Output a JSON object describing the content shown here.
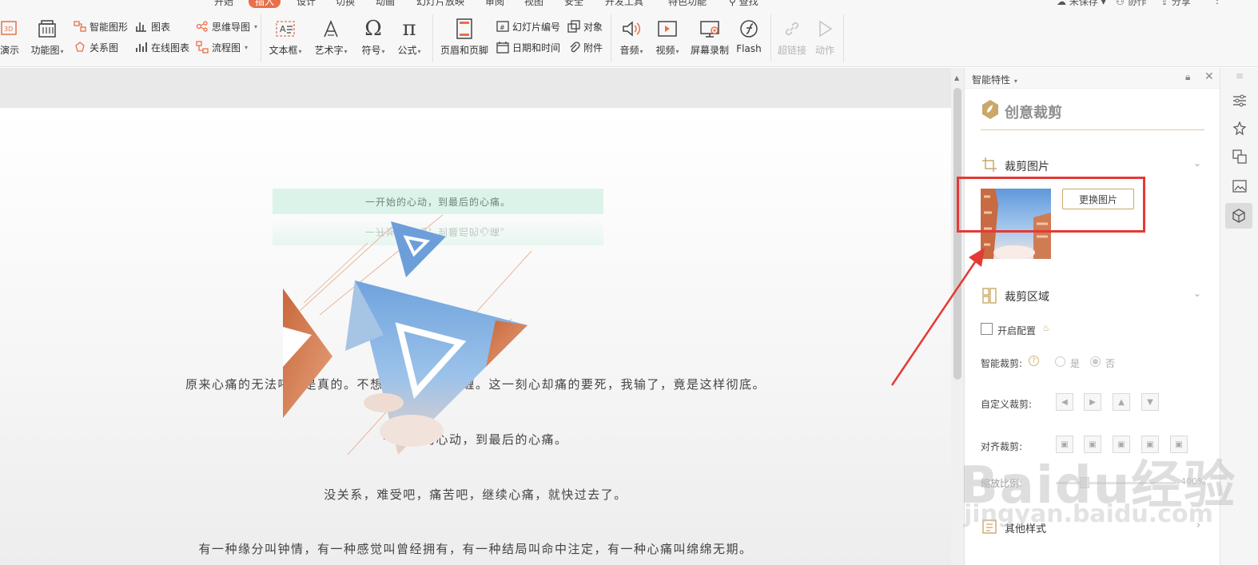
{
  "ribbon": {
    "tabs": [
      "开始",
      "插入",
      "设计",
      "切换",
      "动画",
      "幻灯片放映",
      "审阅",
      "视图",
      "安全",
      "开发工具",
      "特色功能"
    ],
    "active_tab": "插入",
    "search_label": "查找",
    "top_right": [
      "未保存",
      "协作",
      "分享"
    ],
    "buttons": {
      "demo": "演示",
      "function_chart": "功能图",
      "smart_graphic": "智能图形",
      "chart": "图表",
      "mind_map": "思维导图",
      "relation_chart": "关系图",
      "online_chart": "在线图表",
      "flowchart": "流程图",
      "textbox": "文本框",
      "wordart": "艺术字",
      "symbol": "符号",
      "formula": "公式",
      "header_footer": "页眉和页脚",
      "slide_number": "幻灯片编号",
      "object": "对象",
      "datetime": "日期和时间",
      "attachment": "附件",
      "audio": "音频",
      "video": "视频",
      "screen_record": "屏幕录制",
      "flash": "Flash",
      "hyperlink": "超链接",
      "action": "动作"
    }
  },
  "slide": {
    "banner_text": "一开始的心动，到最后的心痛。",
    "lines": [
      "原来心痛的无法呼吸是真的。不想纠缠，不想纠缠。这一刻心却痛的要死，我输了，竟是这样彻底。",
      "一开始的心动，到最后的心痛。",
      "没关系，难受吧，痛苦吧，继续心痛，就快过去了。",
      "有一种缘分叫钟情，有一种感觉叫曾经拥有，有一种结局叫命中注定，有一种心痛叫绵绵无期。"
    ]
  },
  "panel": {
    "header": "智能特性",
    "brand_title": "创意裁剪",
    "crop_image_title": "裁剪图片",
    "replace_button": "更换图片",
    "crop_area_title": "裁剪区域",
    "enable_config": "开启配置",
    "smart_crop_label": "智能裁剪:",
    "smart_crop_yes": "是",
    "smart_crop_no": "否",
    "custom_crop_label": "自定义裁剪:",
    "align_crop_label": "对齐裁剪:",
    "scale_label": "缩放比例:",
    "scale_max": "400%",
    "more_style": "其他样式"
  },
  "watermark": {
    "brand": "Baidu经验",
    "url": "jingyan.baidu.com"
  },
  "colors": {
    "accent_tab": "#e8704a",
    "highlight_box": "#e53935",
    "arrow": "#e53935",
    "banner_bg": "#dcf3e9",
    "brand_gold": "#c9a86a"
  }
}
